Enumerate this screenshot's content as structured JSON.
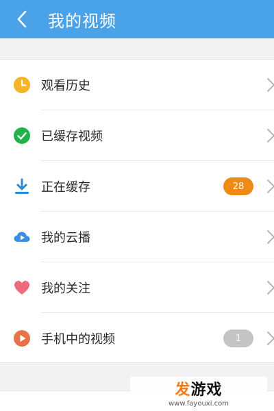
{
  "header": {
    "title": "我的视频",
    "back_icon": "chevron-left-icon",
    "bg_color": "#4aa3e8"
  },
  "menu": {
    "items": [
      {
        "label": "观看历史",
        "icon": "clock-icon",
        "color": "#f5b52a"
      },
      {
        "label": "已缓存视频",
        "icon": "check-circle-icon",
        "color": "#22b24c"
      },
      {
        "label": "正在缓存",
        "icon": "download-icon",
        "color": "#2a8ad6",
        "badge": "28"
      },
      {
        "label": "我的云播",
        "icon": "cloud-play-icon",
        "color": "#3b8fdc"
      },
      {
        "label": "我的关注",
        "icon": "heart-icon",
        "color": "#f06a7e"
      },
      {
        "label": "手机中的视频",
        "icon": "play-circle-icon",
        "color": "#e8734a",
        "badge": "1"
      }
    ]
  },
  "watermark": {
    "brand_accent": "发",
    "brand_rest": "游戏",
    "url": "www.fayouxi.com"
  }
}
